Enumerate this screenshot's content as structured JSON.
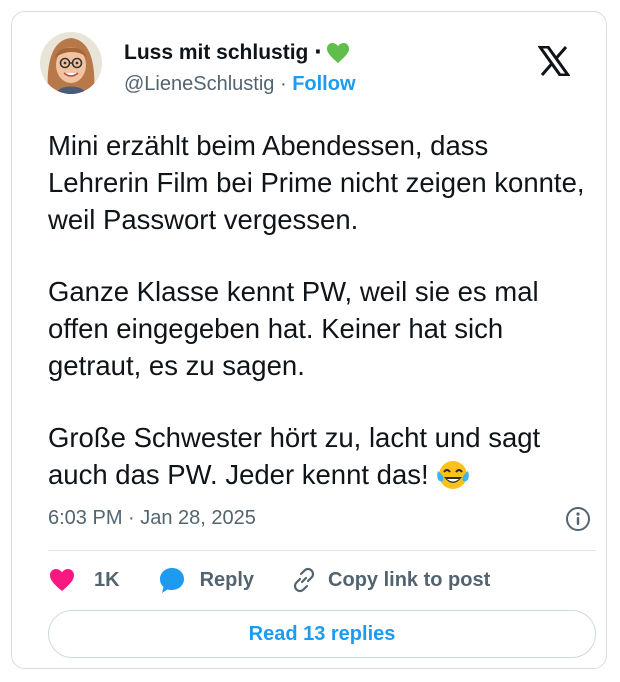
{
  "author": {
    "display_name": "Luss mit schlustig ‧",
    "handle": "@LieneSchlustig",
    "separator": "·",
    "follow_label": "Follow"
  },
  "tweet": {
    "paragraphs": [
      "Mini erzählt beim Abendessen, dass Lehrerin Film bei Prime nicht zeigen konnte, weil Passwort vergessen.",
      "Ganze Klasse kennt PW, weil sie es mal offen eingegeben hat. Keiner hat sich getraut, es zu sagen.",
      "Große Schwester hört zu, lacht und sagt auch das PW. Jeder kennt das!"
    ],
    "emoji": "face-with-tears-of-joy",
    "timestamp": "6:03 PM · Jan 28, 2025"
  },
  "actions": {
    "like_count": "1K",
    "reply_label": "Reply",
    "copy_label": "Copy link to post"
  },
  "read_replies_label": "Read 13 replies",
  "colors": {
    "like": "#f91880",
    "reply": "#1d9bf0",
    "link": "#1d9bf0",
    "text": "#0f1419",
    "muted": "#536471",
    "green_heart": "#5fbf4a"
  }
}
